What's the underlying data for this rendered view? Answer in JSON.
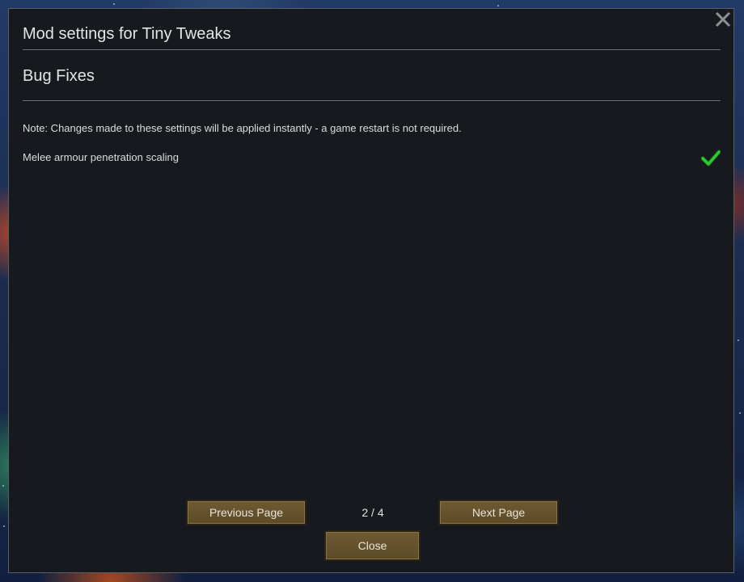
{
  "window": {
    "title": "Mod settings for Tiny Tweaks",
    "close_icon": "close-icon"
  },
  "section": {
    "title": "Bug Fixes",
    "note": "Note: Changes made to these settings will be applied instantly - a game restart is not required."
  },
  "settings": [
    {
      "label": "Melee armour penetration scaling",
      "checked": true,
      "check_icon": "checkmark-icon",
      "check_color": "#2ecc2e"
    }
  ],
  "pagination": {
    "previous_label": "Previous Page",
    "next_label": "Next Page",
    "page_indicator": "2 / 4"
  },
  "footer": {
    "close_label": "Close"
  },
  "colors": {
    "button_fill": "#6e5a32",
    "window_bg": "#16191d"
  }
}
